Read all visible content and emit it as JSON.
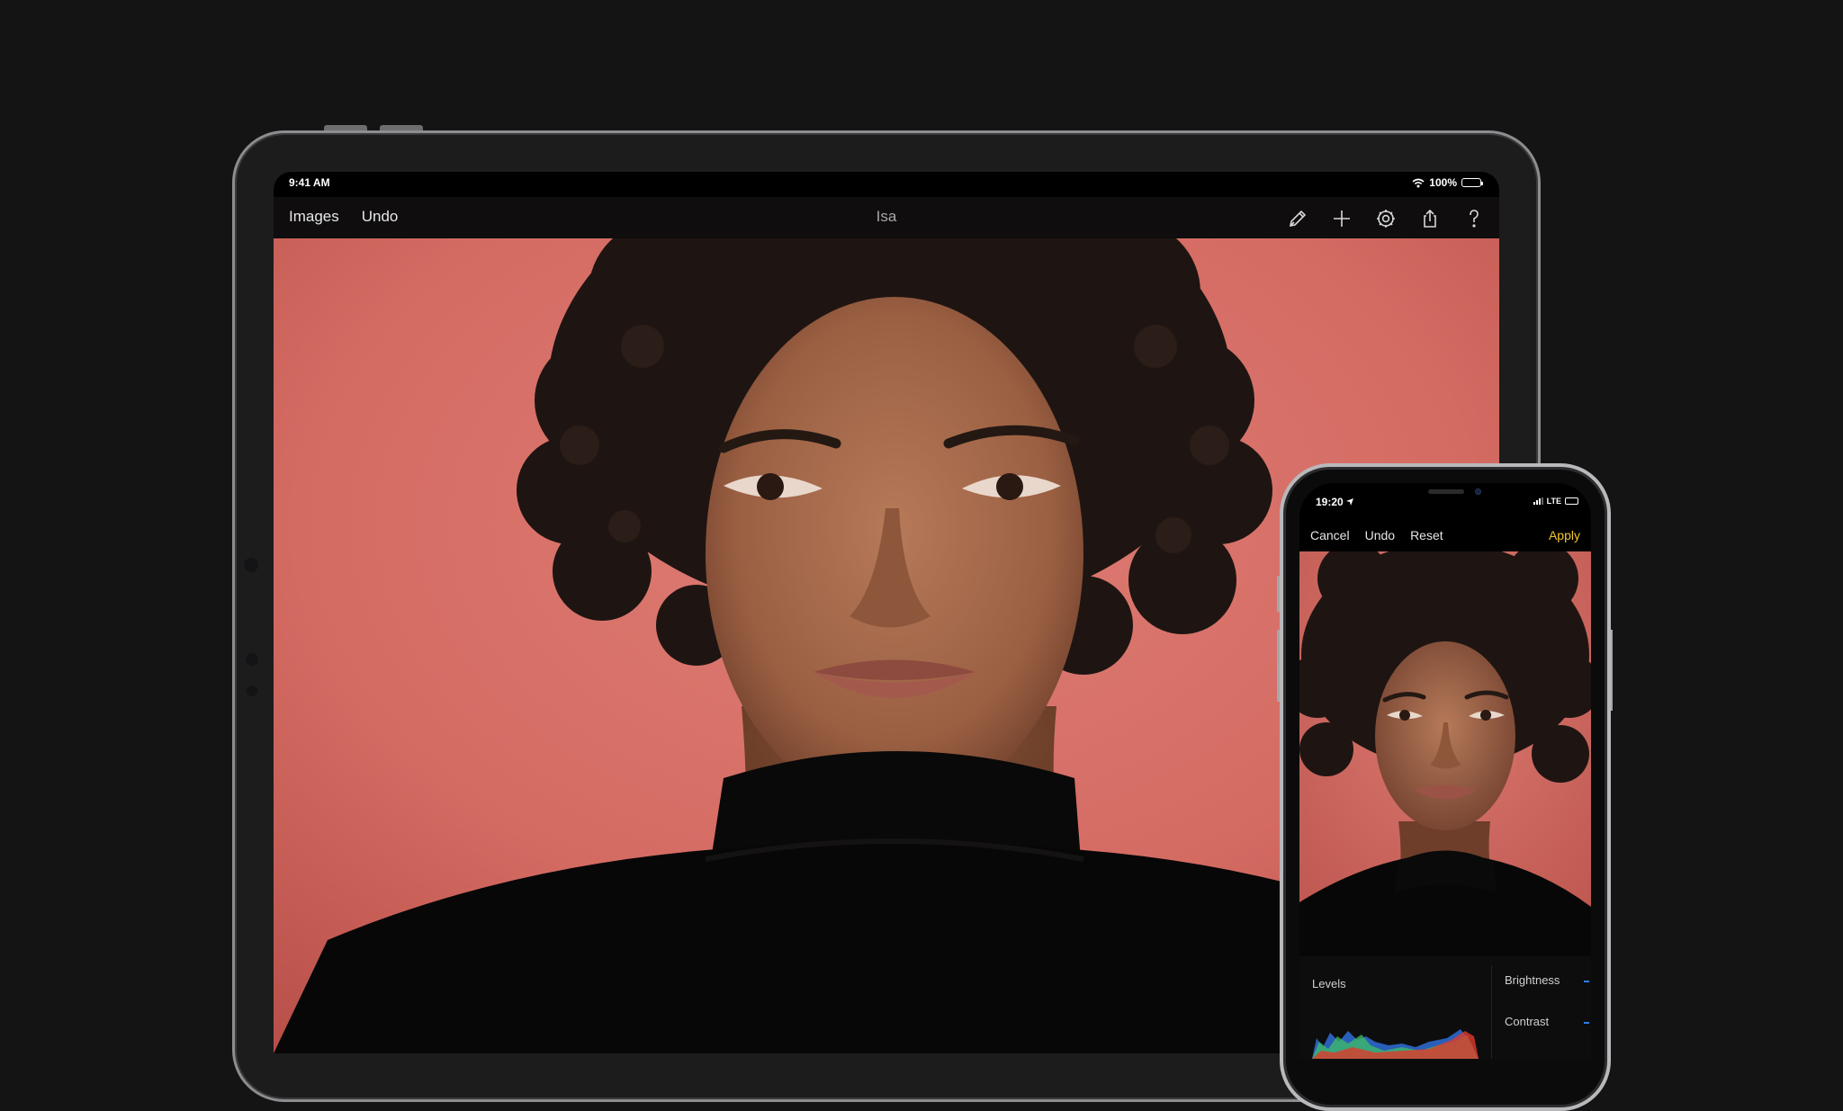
{
  "ipad": {
    "status": {
      "time": "9:41 AM",
      "battery": "100%"
    },
    "toolbar": {
      "left": [
        "Images",
        "Undo"
      ],
      "title": "Isa",
      "icons": [
        "edit-icon",
        "add-icon",
        "settings-icon",
        "share-icon",
        "help-icon"
      ]
    }
  },
  "iphone": {
    "status": {
      "time": "19:20",
      "network": "LTE"
    },
    "toolbar": {
      "cancel": "Cancel",
      "undo": "Undo",
      "reset": "Reset",
      "apply": "Apply"
    },
    "panel": {
      "levels": "Levels",
      "adjustments": [
        "Brightness",
        "Contrast"
      ]
    }
  },
  "colors": {
    "background": "#141414",
    "wall": "#d76e66",
    "apply": "#f4c430",
    "slider": "#2d7ff0"
  }
}
